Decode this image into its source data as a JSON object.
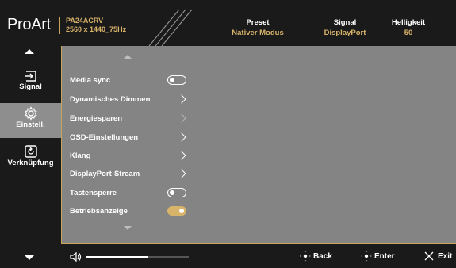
{
  "header": {
    "logo": "ProArt",
    "model_name": "PA24ACRV",
    "resolution": "2560 x 1440_75Hz",
    "preset_title": "Preset",
    "preset_value": "Nativer Modus",
    "signal_title": "Signal",
    "signal_value": "DisplayPort",
    "brightness_title": "Helligkeit",
    "brightness_value": "50"
  },
  "sidebar": {
    "items": [
      {
        "label": "Signal",
        "icon": "input-arrow-icon"
      },
      {
        "label": "Einstell.",
        "icon": "gear-icon"
      },
      {
        "label": "Verknüpfung",
        "icon": "refresh-shortcut-icon"
      }
    ]
  },
  "menu": {
    "items": [
      {
        "label": "Media sync",
        "control": "toggle",
        "on": false
      },
      {
        "label": "Dynamisches Dimmen",
        "control": "chevron"
      },
      {
        "label": "Energiesparen",
        "control": "chevron",
        "dimmed": true
      },
      {
        "label": "OSD-Einstellungen",
        "control": "chevron"
      },
      {
        "label": "Klang",
        "control": "chevron"
      },
      {
        "label": "DisplayPort-Stream",
        "control": "chevron"
      },
      {
        "label": "Tastensperre",
        "control": "toggle",
        "on": false
      },
      {
        "label": "Betriebsanzeige",
        "control": "toggle",
        "on": true
      }
    ]
  },
  "footer": {
    "volume_fraction": 0.6,
    "back_label": "Back",
    "enter_label": "Enter",
    "exit_label": "Exit"
  },
  "colors": {
    "accent": "#d8b36a",
    "panel": "#848484",
    "active_nav": "#8e8e8e",
    "background": "#1a1a1a"
  }
}
